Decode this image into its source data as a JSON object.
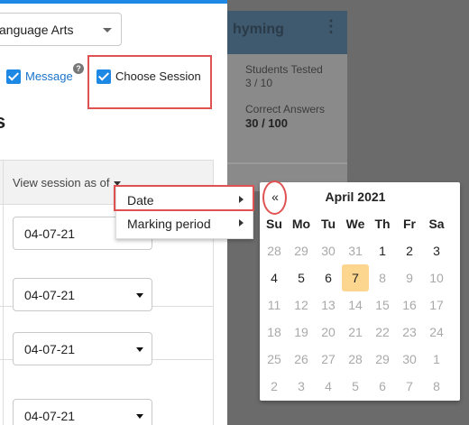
{
  "background_card": {
    "title": "hyming",
    "students_tested_label": "Students Tested",
    "students_tested_value": "3 / 10",
    "correct_answers_label": "Correct Answers",
    "correct_answers_value": "30 / 100"
  },
  "panel": {
    "subject_select_value": "anguage Arts",
    "message_label": "Message",
    "choose_session_label": "Choose Session",
    "section_heading": "s",
    "column_header": "View session as of",
    "rows": [
      "04-07-21",
      "04-07-21",
      "04-07-21",
      "04-07-21"
    ]
  },
  "context_menu": {
    "items": [
      "Date",
      "Marking period"
    ]
  },
  "calendar": {
    "prev_label": "«",
    "title": "April 2021",
    "weekdays": [
      "Su",
      "Mo",
      "Tu",
      "We",
      "Th",
      "Fr",
      "Sa"
    ],
    "weeks": [
      [
        "28",
        "29",
        "30",
        "31",
        "1",
        "2",
        "3"
      ],
      [
        "4",
        "5",
        "6",
        "7",
        "8",
        "9",
        "10"
      ],
      [
        "11",
        "12",
        "13",
        "14",
        "15",
        "16",
        "17"
      ],
      [
        "18",
        "19",
        "20",
        "21",
        "22",
        "23",
        "24"
      ],
      [
        "25",
        "26",
        "27",
        "28",
        "29",
        "30",
        "1"
      ],
      [
        "2",
        "3",
        "4",
        "5",
        "6",
        "7",
        "8"
      ]
    ]
  },
  "colors": {
    "accent": "#1e88e5",
    "highlight": "#e05252",
    "today": "#fcd58e"
  }
}
